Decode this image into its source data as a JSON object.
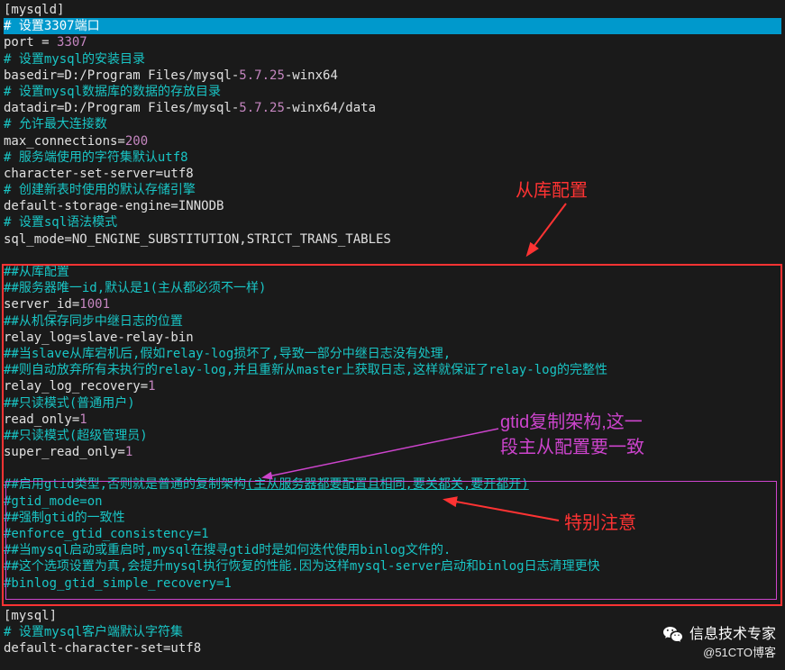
{
  "config": {
    "section": "[mysqld]",
    "c_port": "# 设置3307端口",
    "port_l": "port = ",
    "port_v": "3307",
    "c_basedir": "# 设置mysql的安装目录",
    "basedir_l": "basedir=D:/Program Files/mysql-",
    "basedir_v": "5.7.25",
    "basedir_s": "-winx64",
    "c_datadir": "# 设置mysql数据库的数据的存放目录",
    "datadir_l": "datadir=D:/Program Files/mysql-",
    "datadir_v": "5.7.25",
    "datadir_s": "-winx64/data",
    "c_maxconn": "# 允许最大连接数",
    "maxconn_l": "max_connections=",
    "maxconn_v": "200",
    "c_charset": "# 服务端使用的字符集默认utf8",
    "charset": "character-set-server=utf8",
    "c_engine": "# 创建新表时使用的默认存储引擎",
    "engine": "default-storage-engine=INNODB",
    "c_sqlmode": "# 设置sql语法模式",
    "sqlmode": "sql_mode=NO_ENGINE_SUBSTITUTION,STRICT_TRANS_TABLES",
    "c_slave": "##从库配置",
    "c_serverid": "##服务器唯一id,默认是1(主从都必须不一样)",
    "serverid_l": "server_id=",
    "serverid_v": "1001",
    "c_relay": "##从机保存同步中继日志的位置",
    "relay": "relay_log=slave-relay-bin",
    "c_slave_down": "##当slave从库宕机后,假如relay-log损坏了,导致一部分中继日志没有处理,",
    "c_slave_down2": "##则自动放弃所有未执行的relay-log,并且重新从master上获取日志,这样就保证了relay-log的完整性",
    "relay_recov_l": "relay_log_recovery=",
    "one": "1",
    "c_readonly": "##只读模式(普通用户)",
    "readonly_l": "read_only=",
    "c_superro": "##只读模式(超级管理员)",
    "superro_l": "super_read_only=",
    "c_gtid": "##启用gtid类型,否则就是普通的复制架构",
    "c_gtid_u": "(主从服务器都要配置且相同,要关都关,要开都开)",
    "gtid_mode": "#gtid_mode=on",
    "c_gtid_cons": "##强制gtid的一致性",
    "gtid_cons": "#enforce_gtid_consistency=1",
    "c_binlog1": "##当mysql启动或重启时,mysql在搜寻gtid时是如何迭代使用binlog文件的.",
    "c_binlog2": "##这个选项设置为真,会提升mysql执行恢复的性能.因为这样mysql-server启动和binlog日志清理更快",
    "binlog_rec": "#binlog_gtid_simple_recovery=1",
    "mysql_section": "[mysql]",
    "c_client": "# 设置mysql客户端默认字符集",
    "client_charset": "default-character-set=utf8"
  },
  "anno": {
    "slave_label": "从库配置",
    "gtid_label1": "gtid复制架构,这一",
    "gtid_label2": "段主从配置要一致",
    "notice": "特别注意"
  },
  "watermark": {
    "brand": "信息技术专家",
    "sub": "@51CTO博客"
  }
}
